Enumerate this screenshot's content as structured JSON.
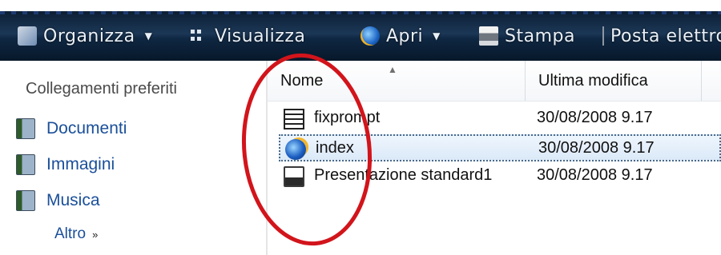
{
  "toolbar": {
    "organize_label": "Organizza",
    "view_label": "Visualizza",
    "open_label": "Apri",
    "print_label": "Stampa",
    "email_label": "Posta elettronica"
  },
  "sidebar": {
    "title": "Collegamenti preferiti",
    "items": [
      {
        "label": "Documenti"
      },
      {
        "label": "Immagini"
      },
      {
        "label": "Musica"
      }
    ],
    "more_label": "Altro",
    "more_chevron": "»"
  },
  "file_list": {
    "columns": [
      "Nome",
      "Ultima modifica"
    ],
    "rows": [
      {
        "name": "fixprompt",
        "modified": "30/08/2008 9.17",
        "icon": "pif-icon"
      },
      {
        "name": "index",
        "modified": "30/08/2008 9.17",
        "icon": "ie-document-icon",
        "selected": true
      },
      {
        "name": "Presentazione standard1",
        "modified": "30/08/2008 9.17",
        "icon": "powerpoint-template-icon"
      }
    ]
  },
  "annotation": {
    "color": "#d2141b",
    "shape": "ellipse"
  },
  "colors": {
    "link": "#1a4f9a",
    "toolbar": "#12304f"
  }
}
